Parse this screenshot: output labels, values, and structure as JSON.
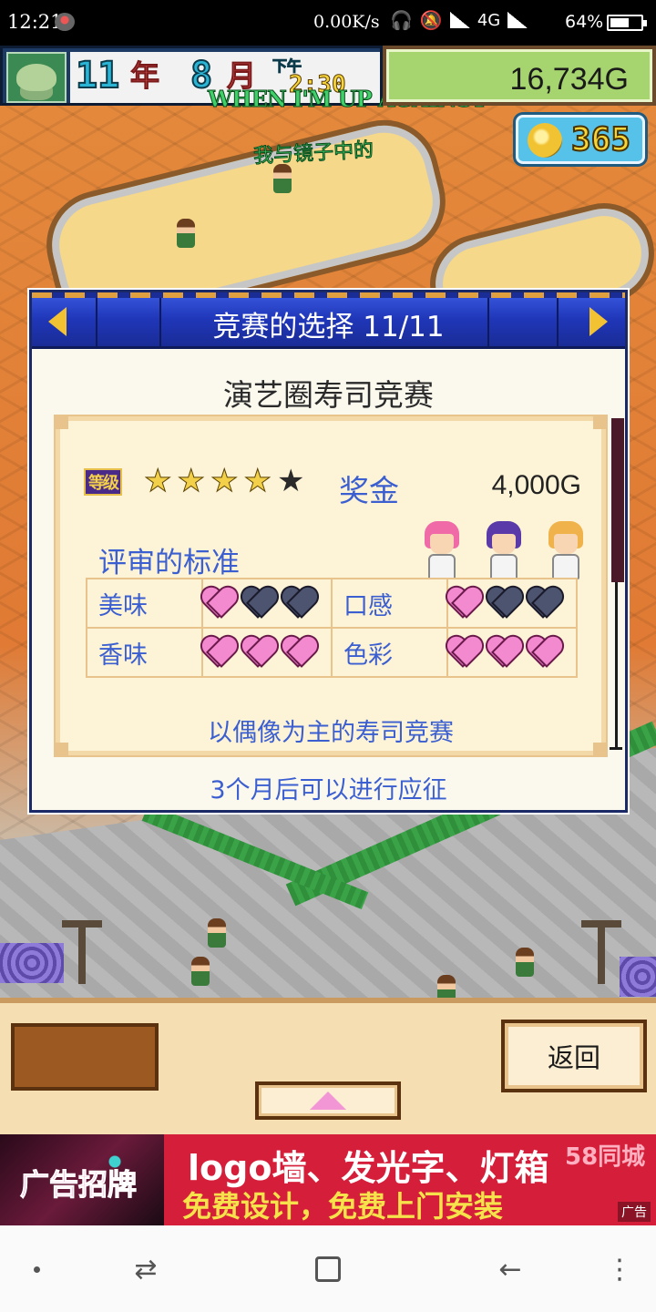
{
  "status_bar": {
    "time": "12:21",
    "network_speed": "0.00K/s",
    "network_type": "4G",
    "battery": "64%",
    "battery_level": 0.64
  },
  "hud": {
    "year_number": "11",
    "year_label": "年",
    "month_number": "8",
    "month_label": "月",
    "ampm": "下午",
    "clock": "2:30",
    "money": "16,734G",
    "coins": "365",
    "lyric_line_1": "WHEN I'M UP AGAINST",
    "lyric_line_2": "我与镜子中的"
  },
  "dialog": {
    "title": "竞赛的选择 11/11",
    "contest_name": "演艺圈寿司竞赛",
    "grade_badge": "等级",
    "stars_total": 5,
    "stars_filled": 4,
    "prize_label": "奖金",
    "prize_value": "4,000G",
    "criteria_title": "评审的标准",
    "criteria": [
      {
        "label": "美味",
        "hearts": 1,
        "max": 3
      },
      {
        "label": "口感",
        "hearts": 1,
        "max": 3
      },
      {
        "label": "香味",
        "hearts": 3,
        "max": 3
      },
      {
        "label": "色彩",
        "hearts": 3,
        "max": 3
      }
    ],
    "description": "以偶像为主的寿司竞赛",
    "apply_note": "3个月后可以进行应征"
  },
  "controls": {
    "back_label": "返回"
  },
  "ad": {
    "photo_text": "广告招牌",
    "line1": "logo墙、发光字、灯箱",
    "line2": "免费设计，免费上门安装",
    "brand": "58同城",
    "tag": "广告"
  },
  "colors": {
    "header_blue": "#1f36b8",
    "label_blue": "#3b5fd0",
    "heart_pink": "#f38ad0",
    "heart_empty": "#4c5470",
    "star_gold": "#f3d04a",
    "money_green": "#a6d46e",
    "ad_red": "#d51f3a"
  }
}
